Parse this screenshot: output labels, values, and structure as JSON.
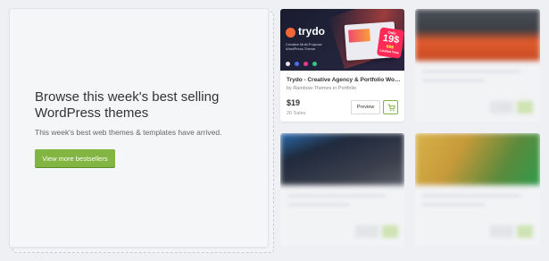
{
  "promo": {
    "title": "Browse this week's best selling WordPress themes",
    "subtitle": "This week's best web themes & templates have arrived.",
    "button_label": "View more bestsellers"
  },
  "featured_item": {
    "thumbnail": {
      "logo_text": "trydo",
      "tagline": "Creative Multi-Purpose WordPress Theme",
      "badge_top": "Only",
      "badge_price": "19$",
      "badge_old_price": "59$",
      "badge_bottom": "Limited Time"
    },
    "title": "Trydo - Creative Agency & Portfolio Wor...",
    "author": "by Rainbow-Themes in Portfolio",
    "price": "$19",
    "sales": "26 Sales",
    "preview_label": "Preview",
    "cart_icon": "cart-icon"
  },
  "colors": {
    "accent_green": "#82b541",
    "page_bg": "#eef0f4",
    "badge_red": "#ff2a56"
  }
}
